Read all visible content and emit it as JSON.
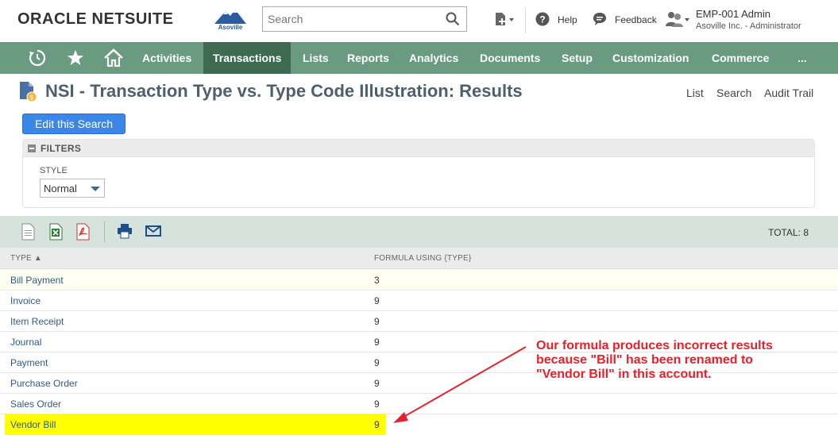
{
  "header": {
    "logo_part1": "ORACLE",
    "logo_part2": "NETSUITE",
    "company_logo_text": "Asoville",
    "search_placeholder": "Search",
    "help_label": "Help",
    "feedback_label": "Feedback",
    "user_name": "EMP-001 Admin",
    "user_role": "Asoville Inc. - Administrator"
  },
  "nav": {
    "items": [
      "Activities",
      "Transactions",
      "Lists",
      "Reports",
      "Analytics",
      "Documents",
      "Setup",
      "Customization",
      "Commerce",
      "..."
    ],
    "active": "Transactions"
  },
  "page": {
    "title": "NSI - Transaction Type vs. Type Code Illustration: Results",
    "links": [
      "List",
      "Search",
      "Audit Trail"
    ],
    "edit_button": "Edit this Search"
  },
  "filters": {
    "heading": "FILTERS",
    "style_label": "STYLE",
    "style_value": "Normal"
  },
  "results": {
    "total_label": "TOTAL: 8",
    "columns": [
      "TYPE ▲",
      "FORMULA USING {TYPE}"
    ],
    "rows": [
      {
        "type": "Bill Payment",
        "formula": "3"
      },
      {
        "type": "Invoice",
        "formula": "9"
      },
      {
        "type": "Item Receipt",
        "formula": "9"
      },
      {
        "type": "Journal",
        "formula": "9"
      },
      {
        "type": "Payment",
        "formula": "9"
      },
      {
        "type": "Purchase Order",
        "formula": "9"
      },
      {
        "type": "Sales Order",
        "formula": "9"
      },
      {
        "type": "Vendor Bill",
        "formula": "9"
      }
    ]
  },
  "annotation": {
    "lines": [
      "Our formula produces incorrect results",
      "because \"Bill\" has been renamed to",
      "\"Vendor Bill\" in this account."
    ],
    "color": "#e8202a"
  },
  "colors": {
    "nav_bg": "#6a9a80",
    "nav_active": "#3f6a52",
    "edit_button": "#3b87e8",
    "toolbar_bg": "#d6e3dc",
    "highlight": "#ffff00"
  }
}
